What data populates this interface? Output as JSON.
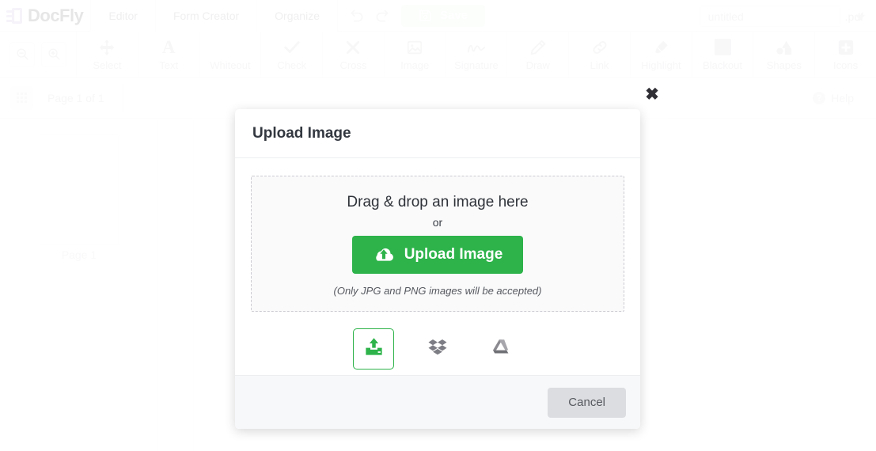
{
  "header": {
    "brand": "DocFly",
    "tabs": [
      {
        "label": "Editor",
        "active": true
      },
      {
        "label": "Form Creator",
        "active": false
      },
      {
        "label": "Organize",
        "active": false
      }
    ],
    "undo_icon": "undo-icon",
    "redo_icon": "redo-icon",
    "save_label": "Save",
    "save_icon": "floppy-disk-icon",
    "filename_value": "",
    "filename_placeholder": "untitled",
    "file_extension": ".pdf"
  },
  "toolbar": {
    "zoom_out_icon": "zoom-out-icon",
    "zoom_in_icon": "zoom-in-icon",
    "tools": [
      {
        "label": "Select",
        "icon": "move-arrows-icon"
      },
      {
        "label": "Text",
        "icon": "letter-a-icon"
      },
      {
        "label": "Whiteout",
        "icon": "white-square-icon"
      },
      {
        "label": "Check",
        "icon": "checkmark-icon"
      },
      {
        "label": "Cross",
        "icon": "cross-x-icon"
      },
      {
        "label": "Image",
        "icon": "picture-icon"
      },
      {
        "label": "Signature",
        "icon": "signature-scribble-icon"
      },
      {
        "label": "Draw",
        "icon": "pencil-icon"
      },
      {
        "label": "Link",
        "icon": "chain-link-icon"
      },
      {
        "label": "Highlight",
        "icon": "highlighter-pen-icon"
      },
      {
        "label": "Blackout",
        "icon": "filled-square-icon"
      },
      {
        "label": "Shapes",
        "icon": "shapes-icon"
      },
      {
        "label": "Icons",
        "icon": "plus-square-icon"
      }
    ]
  },
  "pagebar": {
    "grid_icon": "grid-view-icon",
    "page_indicator": "Page 1 of 1",
    "help_label": "Help",
    "help_icon": "question-circle-icon"
  },
  "sidebar": {
    "thumbnails": [
      {
        "label": "Page 1"
      }
    ]
  },
  "modal": {
    "title": "Upload Image",
    "close_icon": "close-x-icon",
    "dropzone": {
      "headline": "Drag & drop an image here",
      "or": "or",
      "button_label": "Upload Image",
      "button_icon": "cloud-upload-icon",
      "note": "(Only JPG and PNG images will be accepted)"
    },
    "sources": [
      {
        "name": "local-upload",
        "icon": "upload-tray-icon",
        "active": true
      },
      {
        "name": "dropbox",
        "icon": "dropbox-icon",
        "active": false
      },
      {
        "name": "google-drive",
        "icon": "google-drive-icon",
        "active": false
      }
    ],
    "cancel_label": "Cancel"
  },
  "colors": {
    "brand_purple": "#b9a7d6",
    "accent_green": "#2db34a",
    "save_green_faded": "#e0f3e3",
    "cancel_gray": "#dcdde0"
  }
}
